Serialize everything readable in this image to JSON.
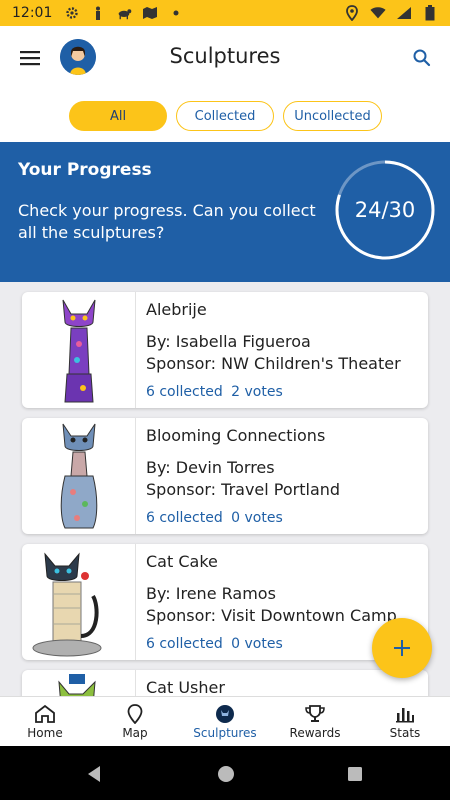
{
  "status_bar": {
    "time": "12:01",
    "left_icons": [
      "gear-icon",
      "figure-icon",
      "animal-icon",
      "map-icon",
      "dot-icon"
    ],
    "right_icons": [
      "location-icon",
      "wifi-icon",
      "signal-icon",
      "battery-icon"
    ]
  },
  "app_bar": {
    "title": "Sculptures",
    "menu_icon": "menu-icon",
    "search_icon": "search-icon"
  },
  "filters": {
    "all": "All",
    "collected": "Collected",
    "uncollected": "Uncollected",
    "selected": "All"
  },
  "progress": {
    "title": "Your Progress",
    "description": "Check your progress. Can you collect all the sculptures?",
    "count_label": "24/30",
    "collected": 24,
    "total": 30
  },
  "sculptures": [
    {
      "name": "Alebrije",
      "artist": "By: Isabella Figueroa",
      "sponsor": "Sponsor: NW Children's Theater",
      "collected": "6 collected",
      "votes": "2 votes"
    },
    {
      "name": "Blooming Connections",
      "artist": "By: Devin Torres",
      "sponsor": "Sponsor: Travel Portland",
      "collected": "6 collected",
      "votes": "0 votes"
    },
    {
      "name": "Cat Cake",
      "artist": "By: Irene Ramos",
      "sponsor": "Sponsor: Visit Downtown Camp",
      "collected": "6 collected",
      "votes": "0 votes"
    },
    {
      "name": "Cat Usher",
      "artist": "",
      "sponsor": "",
      "collected": "",
      "votes": ""
    }
  ],
  "fab": {
    "label": "+"
  },
  "bottom_nav": [
    {
      "label": "Home",
      "icon": "home-icon"
    },
    {
      "label": "Map",
      "icon": "map-pin-icon"
    },
    {
      "label": "Sculptures",
      "icon": "cat-icon"
    },
    {
      "label": "Rewards",
      "icon": "trophy-icon"
    },
    {
      "label": "Stats",
      "icon": "bar-chart-icon"
    }
  ],
  "active_tab": "Sculptures",
  "colors": {
    "accent": "#fcc419",
    "brand_blue": "#1f5fa6",
    "background": "#ececef"
  }
}
